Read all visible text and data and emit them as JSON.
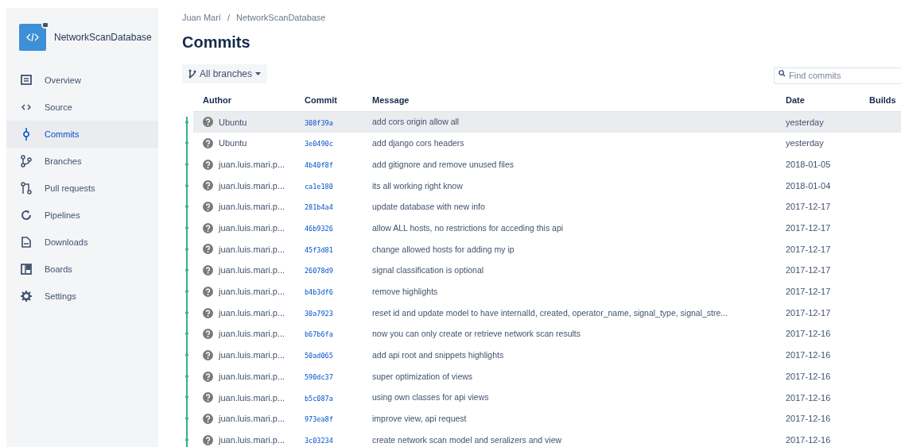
{
  "sidebar": {
    "repo_name": "NetworkScanDatabase",
    "items": [
      {
        "label": "Overview",
        "selected": false
      },
      {
        "label": "Source",
        "selected": false
      },
      {
        "label": "Commits",
        "selected": true
      },
      {
        "label": "Branches",
        "selected": false
      },
      {
        "label": "Pull requests",
        "selected": false
      },
      {
        "label": "Pipelines",
        "selected": false
      },
      {
        "label": "Downloads",
        "selected": false
      },
      {
        "label": "Boards",
        "selected": false
      },
      {
        "label": "Settings",
        "selected": false
      }
    ]
  },
  "breadcrumb": {
    "items": [
      "Juan Marí",
      "NetworkScanDatabase"
    ],
    "separator": "/"
  },
  "title": "Commits",
  "branch_filter": {
    "label": "All branches"
  },
  "search": {
    "placeholder": "Find commits"
  },
  "table": {
    "columns": [
      "Author",
      "Commit",
      "Message",
      "Date",
      "Builds"
    ],
    "rows": [
      {
        "author": "Ubuntu",
        "commit": "308f39a",
        "message": "add cors origin allow all",
        "date": "yesterday",
        "selected": true
      },
      {
        "author": "Ubuntu",
        "commit": "3e0490c",
        "message": "add django cors headers",
        "date": "yesterday",
        "selected": false
      },
      {
        "author": "juan.luis.mari.p...",
        "commit": "4b40f8f",
        "message": "add gitignore and remove unused files",
        "date": "2018-01-05",
        "selected": false
      },
      {
        "author": "juan.luis.mari.p...",
        "commit": "ca1e180",
        "message": "its all working right know",
        "date": "2018-01-04",
        "selected": false
      },
      {
        "author": "juan.luis.mari.p...",
        "commit": "281b4a4",
        "message": "update database with new info",
        "date": "2017-12-17",
        "selected": false
      },
      {
        "author": "juan.luis.mari.p...",
        "commit": "46b9326",
        "message": "allow ALL hosts, no restrictions for acceding this api",
        "date": "2017-12-17",
        "selected": false
      },
      {
        "author": "juan.luis.mari.p...",
        "commit": "45f3d81",
        "message": "change allowed hosts for adding my ip",
        "date": "2017-12-17",
        "selected": false
      },
      {
        "author": "juan.luis.mari.p...",
        "commit": "26078d9",
        "message": "signal classification is optional",
        "date": "2017-12-17",
        "selected": false
      },
      {
        "author": "juan.luis.mari.p...",
        "commit": "b4b3df6",
        "message": "remove highlights",
        "date": "2017-12-17",
        "selected": false
      },
      {
        "author": "juan.luis.mari.p...",
        "commit": "30a7923",
        "message": "reset id and update model to have internalId, created, operator_name, signal_type, signal_stre...",
        "date": "2017-12-17",
        "selected": false
      },
      {
        "author": "juan.luis.mari.p...",
        "commit": "b67b6fa",
        "message": "now you can only create or retrieve network scan results",
        "date": "2017-12-16",
        "selected": false
      },
      {
        "author": "juan.luis.mari.p...",
        "commit": "50ad065",
        "message": "add api root and snippets highlights",
        "date": "2017-12-16",
        "selected": false
      },
      {
        "author": "juan.luis.mari.p...",
        "commit": "590dc37",
        "message": "super optimization of views",
        "date": "2017-12-16",
        "selected": false
      },
      {
        "author": "juan.luis.mari.p...",
        "commit": "b5c087a",
        "message": "using own classes for api views",
        "date": "2017-12-16",
        "selected": false
      },
      {
        "author": "juan.luis.mari.p...",
        "commit": "973ea8f",
        "message": "improve view, api request",
        "date": "2017-12-16",
        "selected": false
      },
      {
        "author": "juan.luis.mari.p...",
        "commit": "3c03234",
        "message": "create network scan model and seralizers and view",
        "date": "2017-12-16",
        "selected": false
      }
    ]
  }
}
